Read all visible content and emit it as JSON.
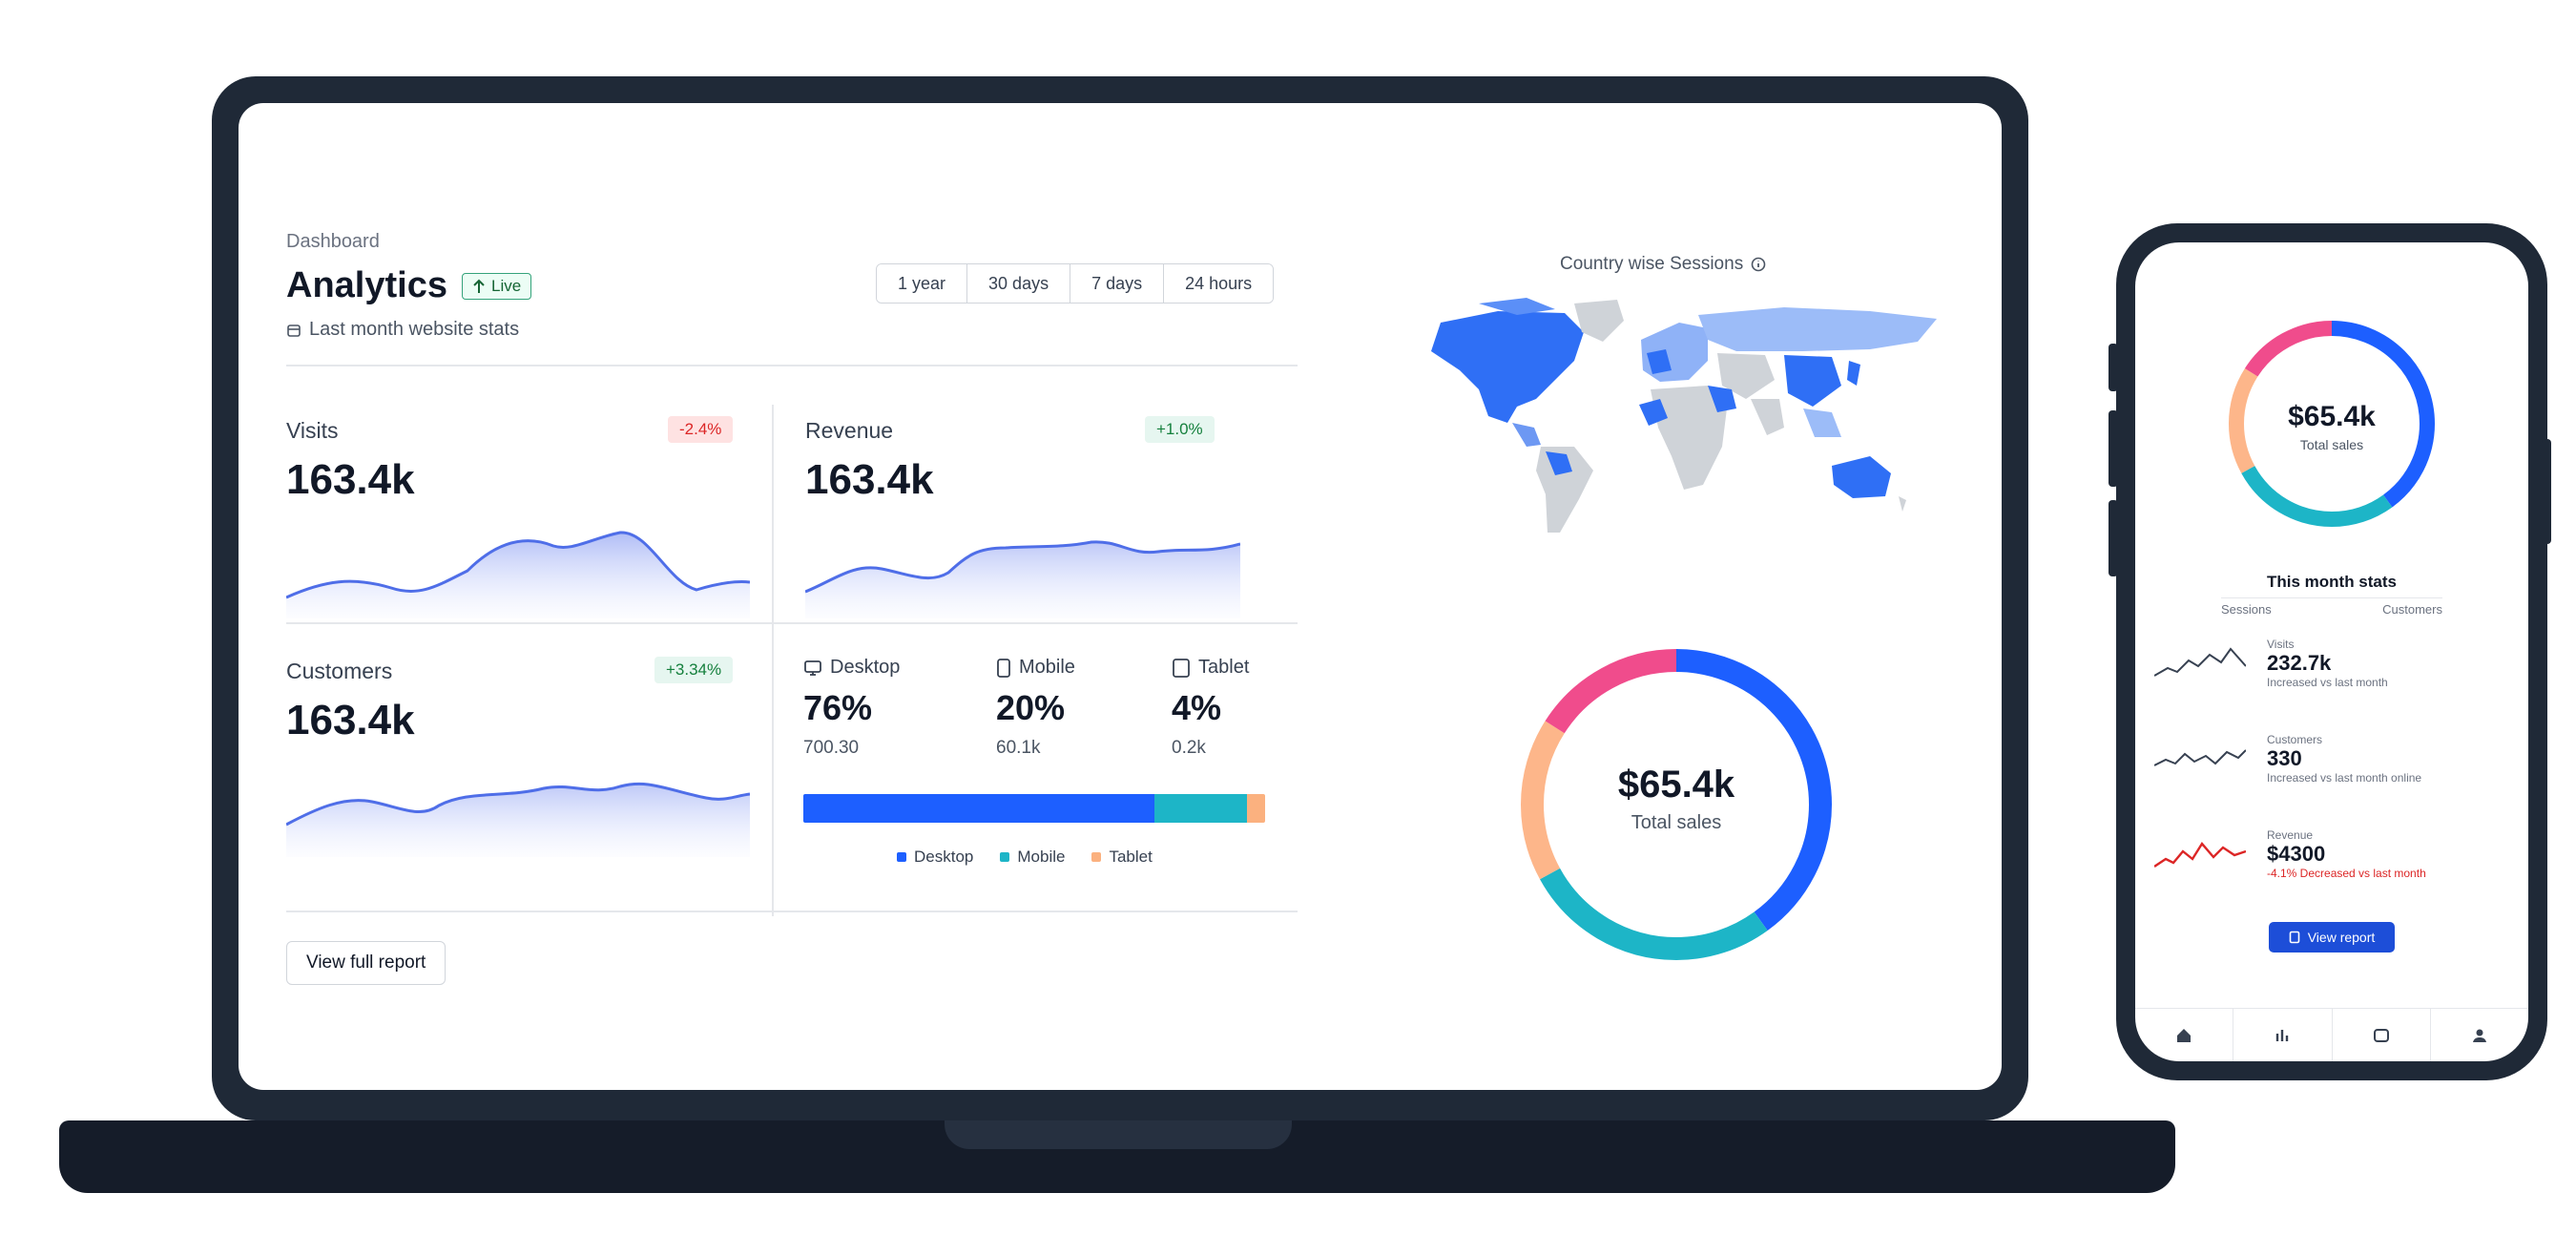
{
  "dashboard": {
    "breadcrumb": "Dashboard",
    "title": "Analytics",
    "title_badge": "Live",
    "subtitle": "Last month website stats",
    "ranges": [
      "1 year",
      "30 days",
      "7 days",
      "24 hours"
    ],
    "report_button": "View full report"
  },
  "cards": {
    "visits": {
      "label": "Visits",
      "value": "163.4k",
      "change": "-2.4%"
    },
    "revenue": {
      "label": "Revenue",
      "value": "163.4k",
      "change": "+1.0%"
    },
    "customers": {
      "label": "Customers",
      "value": "163.4k",
      "change": "+3.34%"
    }
  },
  "devices": {
    "desktop": {
      "label": "Desktop",
      "pct": "76%",
      "count": "700.30"
    },
    "mobile": {
      "label": "Mobile",
      "pct": "20%",
      "count": "60.1k"
    },
    "tablet": {
      "label": "Tablet",
      "pct": "4%",
      "count": "0.2k"
    },
    "split": [
      76,
      20,
      4
    ],
    "colors": [
      "#1d5fff",
      "#1db5c7",
      "#fbb17f"
    ],
    "legend": [
      "Desktop",
      "Mobile",
      "Tablet"
    ]
  },
  "map": {
    "title": "Country wise Sessions"
  },
  "donut": {
    "value": "$65.4k",
    "label": "Total sales",
    "segments": [
      {
        "value": 40,
        "color": "#1d5fff"
      },
      {
        "value": 27,
        "color": "#1db5c7"
      },
      {
        "value": 17,
        "color": "#fdb68a"
      },
      {
        "value": 16,
        "color": "#f04c8c"
      }
    ]
  },
  "phone": {
    "donut_value": "$65.4k",
    "donut_label": "Total sales",
    "section_title": "This month stats",
    "tabs": [
      "Sessions",
      "Customers"
    ],
    "rows": [
      {
        "label": "Visits",
        "value": "232.7k",
        "meta": "Increased vs last month",
        "color": "#374151"
      },
      {
        "label": "Customers",
        "value": "330",
        "meta": "Increased vs last month online",
        "color": "#374151"
      },
      {
        "label": "Revenue",
        "value": "$4300",
        "meta": "-4.1% Decreased vs last month",
        "color": "#dc2626"
      }
    ],
    "cta": "View report",
    "nav": [
      "home-icon",
      "chart-icon",
      "device-icon",
      "user-icon"
    ]
  }
}
